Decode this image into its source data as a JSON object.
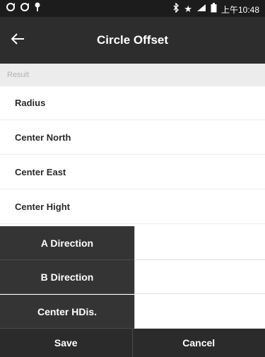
{
  "status_bar": {
    "time": "上午10:48",
    "left_icons": [
      "sync-icon",
      "sync-icon",
      "location-pin-icon"
    ],
    "right_icons": [
      "bluetooth-icon",
      "star-icon",
      "signal-icon",
      "battery-icon"
    ]
  },
  "app_bar": {
    "title": "Circle Offset",
    "back_icon": "arrow-left-icon"
  },
  "section": {
    "header": "Result"
  },
  "results": [
    {
      "label": "Radius"
    },
    {
      "label": "Center North"
    },
    {
      "label": "Center East"
    },
    {
      "label": "Center Hight"
    }
  ],
  "inputs": [
    {
      "label": "A Direction",
      "value": ""
    },
    {
      "label": "B Direction",
      "value": ""
    },
    {
      "label": "Center HDis.",
      "value": ""
    }
  ],
  "actions": {
    "save_label": "Save",
    "cancel_label": "Cancel"
  },
  "colors": {
    "status_bar": "#1c1c1c",
    "app_bar": "#2d2d2d",
    "label_cell": "#343434",
    "bottom_bar": "#2b2b2b",
    "section_header": "#ececec"
  }
}
